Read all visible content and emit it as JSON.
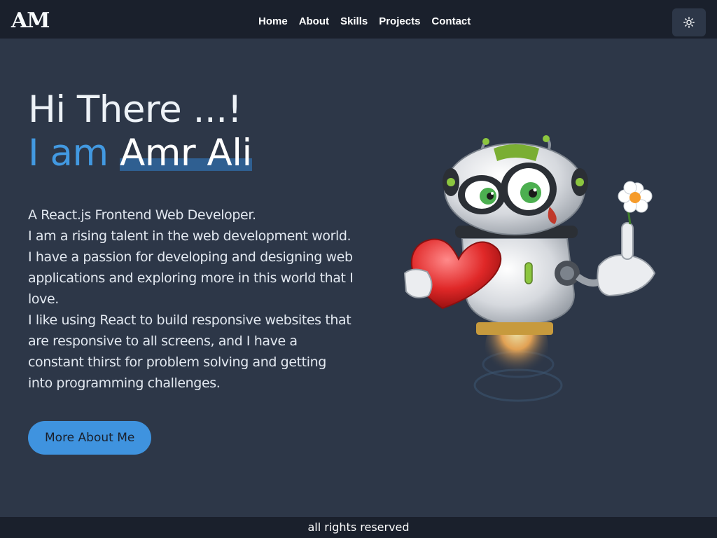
{
  "navbar": {
    "logo": "AM",
    "links": [
      "Home",
      "About",
      "Skills",
      "Projects",
      "Contact"
    ],
    "theme_icon": "sun-icon"
  },
  "hero": {
    "greeting": "Hi There ...!",
    "intro_prefix": "I am",
    "name": "Amr Ali",
    "bio": [
      "A React.js Frontend Web Developer.",
      "I am a rising talent in the web development world. I have a passion for developing and designing web applications and exploring more in this world that I love.",
      "I like using React to build responsive websites that are responsive to all screens, and I have a constant thirst for problem solving and getting into programming challenges."
    ],
    "cta_label": "More About Me",
    "illustration": "robot-illustration"
  },
  "colors": {
    "background": "#2d3748",
    "navbar": "#1a202c",
    "accent": "#4299e1",
    "button": "#3f93df"
  },
  "footer": {
    "text": "all rights reserved"
  }
}
